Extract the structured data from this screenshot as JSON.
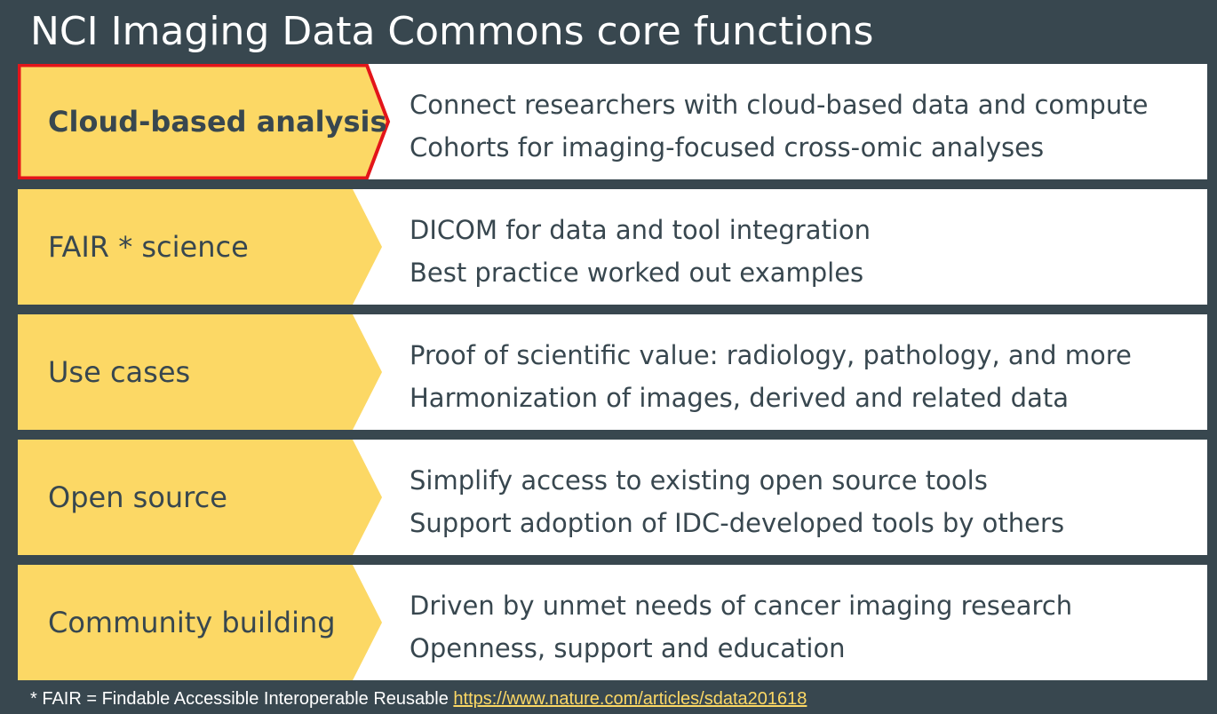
{
  "title": "NCI Imaging Data Commons core functions",
  "colors": {
    "background": "#38474f",
    "chevron_fill": "#fcd865",
    "highlight_border": "#e3151a",
    "text_dark": "#38474f",
    "link": "#fcd865"
  },
  "rows": [
    {
      "label": "Cloud-based analysis",
      "highlighted": true,
      "lines": [
        "Connect researchers with cloud-based data and compute",
        "Cohorts for imaging-focused cross-omic analyses"
      ]
    },
    {
      "label": "FAIR * science",
      "highlighted": false,
      "lines": [
        "DICOM for data and tool integration",
        "Best practice worked out examples"
      ]
    },
    {
      "label": "Use cases",
      "highlighted": false,
      "lines": [
        "Proof of scientific value: radiology, pathology, and more",
        "Harmonization of images, derived and related data"
      ]
    },
    {
      "label": "Open source",
      "highlighted": false,
      "lines": [
        "Simplify access to existing open source tools",
        "Support adoption of IDC-developed tools by others"
      ]
    },
    {
      "label": "Community building",
      "highlighted": false,
      "lines": [
        "Driven by unmet needs of cancer imaging research",
        "Openness, support and education"
      ]
    }
  ],
  "footnote": {
    "text": "* FAIR = Findable Accessible Interoperable Reusable ",
    "link_text": "https://www.nature.com/articles/sdata201618"
  }
}
